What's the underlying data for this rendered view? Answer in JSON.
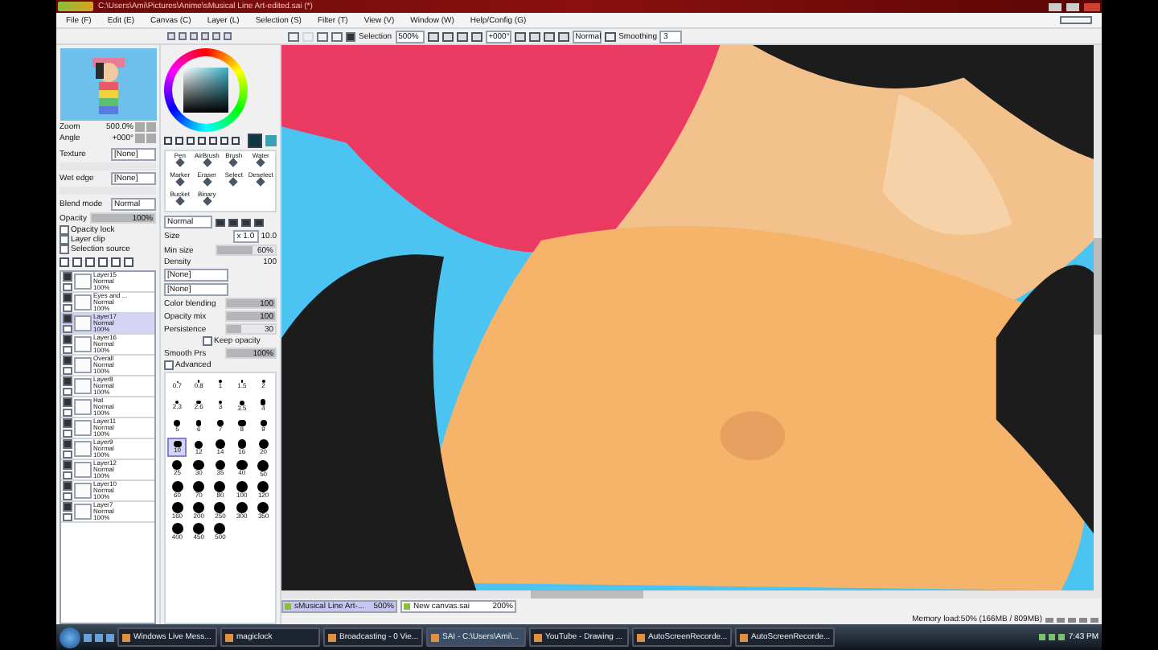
{
  "window": {
    "title": "C:\\Users\\Ami\\Pictures\\Anime\\sMusical Line Art-edited.sai (*)"
  },
  "menu": [
    "File (F)",
    "Edit (E)",
    "Canvas (C)",
    "Layer (L)",
    "Selection (S)",
    "Filter (T)",
    "View (V)",
    "Window (W)",
    "Help/Config (G)"
  ],
  "toolbar": {
    "selection_label": "Selection",
    "selection_checked": true,
    "zoom": "500%",
    "angle": "+000°",
    "blend": "Normal",
    "smoothing_label": "Smoothing",
    "smoothing": "3"
  },
  "navigator": {
    "zoom_label": "Zoom",
    "zoom": "500.0%",
    "angle_label": "Angle",
    "angle": "+000°"
  },
  "layer_props": {
    "texture_label": "Texture",
    "texture": "[None]",
    "wet_edge_label": "Wet edge",
    "wet_edge": "[None]",
    "blend_label": "Blend mode",
    "blend": "Normal",
    "opacity_label": "Opacity",
    "opacity": "100%",
    "level": 1
  },
  "layer_options": [
    {
      "label": "Opacity lock",
      "checked": false
    },
    {
      "label": "Layer clip",
      "checked": false
    },
    {
      "label": "Selection source",
      "checked": false
    }
  ],
  "layers": [
    {
      "name": "Layer15",
      "mode": "Normal",
      "opacity": "100%",
      "visible": true,
      "selected": false
    },
    {
      "name": "Eyes and ...",
      "mode": "Normal",
      "opacity": "100%",
      "visible": true,
      "selected": false
    },
    {
      "name": "Layer17",
      "mode": "Normal",
      "opacity": "100%",
      "visible": true,
      "selected": true
    },
    {
      "name": "Layer16",
      "mode": "Normal",
      "opacity": "100%",
      "visible": true,
      "selected": false
    },
    {
      "name": "Overall",
      "mode": "Normal",
      "opacity": "100%",
      "visible": true,
      "selected": false
    },
    {
      "name": "Layer8",
      "mode": "Normal",
      "opacity": "100%",
      "visible": true,
      "selected": false
    },
    {
      "name": "Hat",
      "mode": "Normal",
      "opacity": "100%",
      "visible": true,
      "selected": false
    },
    {
      "name": "Layer11",
      "mode": "Normal",
      "opacity": "100%",
      "visible": true,
      "selected": false
    },
    {
      "name": "Layer9",
      "mode": "Normal",
      "opacity": "100%",
      "visible": true,
      "selected": false
    },
    {
      "name": "Layer12",
      "mode": "Normal",
      "opacity": "100%",
      "visible": true,
      "selected": false
    },
    {
      "name": "Layer10",
      "mode": "Normal",
      "opacity": "100%",
      "visible": true,
      "selected": false
    },
    {
      "name": "Layer7",
      "mode": "Normal",
      "opacity": "100%",
      "visible": true,
      "selected": false
    }
  ],
  "tools": [
    "Pen",
    "AirBrush",
    "Brush",
    "Water",
    "Marker",
    "Eraser",
    "Select",
    "Deselect",
    "Bucket",
    "Binary"
  ],
  "brush": {
    "mode": "Normal",
    "size_label": "Size",
    "size_mult": "x 1.0",
    "size": "10.0",
    "min_size": {
      "label": "Min size",
      "value": "60%",
      "level": 0.6
    },
    "density_label": "Density",
    "density": "100",
    "texture_1": "[None]",
    "texture_2": "[None]",
    "sliders": [
      {
        "label": "Color blending",
        "value": "100",
        "level": 1
      },
      {
        "label": "Opacity mix",
        "value": "100",
        "level": 1
      },
      {
        "label": "Persistence",
        "value": "30",
        "level": 0.3
      }
    ],
    "keep_opacity_label": "Keep opacity",
    "keep_opacity": false,
    "smooth": {
      "label": "Smooth Prs",
      "value": "100%",
      "level": 1
    },
    "advanced_label": "Advanced",
    "advanced": false
  },
  "brush_sizes": [
    {
      "size": "0.7",
      "selected": false
    },
    {
      "size": "0.8",
      "selected": false
    },
    {
      "size": "1",
      "selected": false
    },
    {
      "size": "1.5",
      "selected": false
    },
    {
      "size": "2",
      "selected": false
    },
    {
      "size": "2.3",
      "selected": false
    },
    {
      "size": "2.6",
      "selected": false
    },
    {
      "size": "3",
      "selected": false
    },
    {
      "size": "3.5",
      "selected": false
    },
    {
      "size": "4",
      "selected": false
    },
    {
      "size": "5",
      "selected": false
    },
    {
      "size": "6",
      "selected": false
    },
    {
      "size": "7",
      "selected": false
    },
    {
      "size": "8",
      "selected": false
    },
    {
      "size": "9",
      "selected": false
    },
    {
      "size": "10",
      "selected": true
    },
    {
      "size": "12",
      "selected": false
    },
    {
      "size": "14",
      "selected": false
    },
    {
      "size": "16",
      "selected": false
    },
    {
      "size": "20",
      "selected": false
    },
    {
      "size": "25",
      "selected": false
    },
    {
      "size": "30",
      "selected": false
    },
    {
      "size": "35",
      "selected": false
    },
    {
      "size": "40",
      "selected": false
    },
    {
      "size": "50",
      "selected": false
    },
    {
      "size": "60",
      "selected": false
    },
    {
      "size": "70",
      "selected": false
    },
    {
      "size": "80",
      "selected": false
    },
    {
      "size": "100",
      "selected": false
    },
    {
      "size": "120",
      "selected": false
    },
    {
      "size": "160",
      "selected": false
    },
    {
      "size": "200",
      "selected": false
    },
    {
      "size": "250",
      "selected": false
    },
    {
      "size": "300",
      "selected": false
    },
    {
      "size": "350",
      "selected": false
    },
    {
      "size": "400",
      "selected": false
    },
    {
      "size": "450",
      "selected": false
    },
    {
      "size": "500",
      "selected": false
    }
  ],
  "canvas_tabs": [
    {
      "name": "sMusical Line Art-...",
      "zoom": "500%",
      "selected": true
    },
    {
      "name": "New canvas.sai",
      "zoom": "200%",
      "selected": false
    }
  ],
  "status_bar": "Memory load:50% (166MB / 809MB)",
  "taskbar": [
    {
      "label": "Windows Live Mess...",
      "selected": false
    },
    {
      "label": "magiclock",
      "selected": false
    },
    {
      "label": "Broadcasting - 0 Vie...",
      "selected": false
    },
    {
      "label": "SAI - C:\\Users\\Ami\\...",
      "selected": true
    },
    {
      "label": "YouTube - Drawing ...",
      "selected": false
    },
    {
      "label": "AutoScreenRecorde...",
      "selected": false
    },
    {
      "label": "AutoScreenRecorde...",
      "selected": false
    }
  ],
  "clock": "7:43 PM"
}
